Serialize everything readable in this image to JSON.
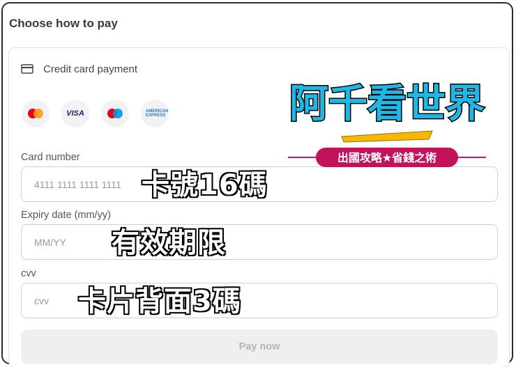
{
  "page": {
    "title": "Choose how to pay"
  },
  "payment_method": {
    "label": "Credit card payment",
    "card_brands": [
      "mastercard-icon",
      "visa-icon",
      "maestro-icon",
      "amex-icon"
    ],
    "visa_text": "VISA",
    "amex_text": "AMERICAN EXPRESS"
  },
  "form": {
    "card_number": {
      "label": "Card number",
      "placeholder": "4111 1111 1111 1111"
    },
    "expiry": {
      "label": "Expiry date (mm/yy)",
      "placeholder": "MM/YY"
    },
    "cvv": {
      "label": "cvv",
      "placeholder": "cvv"
    },
    "submit_label": "Pay now"
  },
  "annotations": {
    "card_number": "卡號16碼",
    "expiry": "有效期限",
    "cvv": "卡片背面3碼"
  },
  "watermark": {
    "title": "阿千看世界",
    "subtitle": "出國攻略★省錢之術"
  },
  "colors": {
    "mastercard_red": "#eb001b",
    "mastercard_orange": "#f79e1b",
    "maestro_blue": "#0099df",
    "visa_blue": "#1a1f71",
    "button_bg": "#efefef",
    "button_text": "#b4b4b4"
  }
}
